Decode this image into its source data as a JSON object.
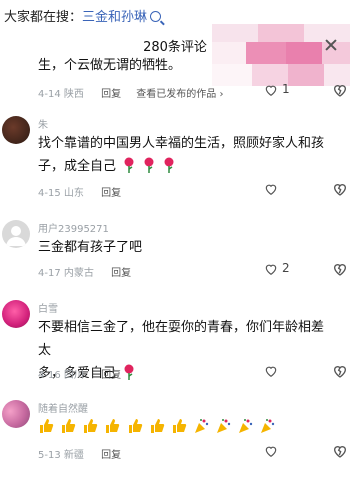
{
  "search_bar": {
    "prefix": "大家都在搜：",
    "keyword": "三金和孙琳"
  },
  "comments_header": {
    "title": "280条评论"
  },
  "comments": [
    {
      "id": "c0",
      "text": "生，个云做无谓的牺牲。",
      "date": "4-14",
      "location": "陕西",
      "reply_label": "回复",
      "extra_label": "查看已发布的作品",
      "likes": "1"
    },
    {
      "id": "c1",
      "username": "朱",
      "text_line1": "找个靠谱的中国男人幸福的生活，照顾好家人和孩",
      "text_line2": "子，成全自己",
      "date": "4-15",
      "location": "山东",
      "reply_label": "回复",
      "likes": ""
    },
    {
      "id": "c2",
      "username": "用户23995271",
      "text": "三金都有孩子了吧",
      "date": "4-17",
      "location": "内蒙古",
      "reply_label": "回复",
      "likes": "2"
    },
    {
      "id": "c3",
      "username": "白雪",
      "text_line1": "不要相信三金了，他在耍你的青春，你们年龄相差太",
      "text_line2": "多，多爱自己",
      "date": "4-16",
      "location": "四川",
      "reply_label": "回复",
      "likes": ""
    },
    {
      "id": "c4",
      "username": "随着自然醒",
      "date": "5-13",
      "location": "新疆",
      "reply_label": "回复",
      "likes": ""
    }
  ],
  "icons": {
    "search": "search-icon",
    "close": "close-icon",
    "like": "heart-outline-icon",
    "dislike": "broken-heart-icon",
    "rose": "rose-emoji",
    "thumbs_up": "thumbs-up-emoji",
    "celebrate": "party-emoji"
  },
  "colors": {
    "keyword": "#3a64b8",
    "meta": "#9aa0a6",
    "rose": "#e0245e"
  }
}
